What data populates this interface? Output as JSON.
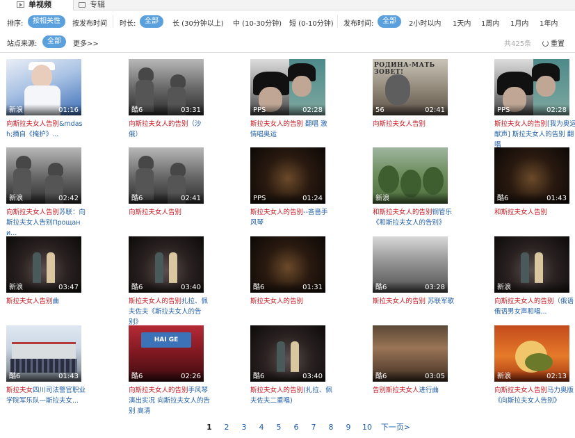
{
  "tabs": {
    "active": "单视频",
    "other": "专辑"
  },
  "filters": {
    "sort_label": "排序:",
    "sort_options": [
      "按相关性",
      "按发布时间"
    ],
    "duration_label": "时长:",
    "duration_options": [
      "全部",
      "长 (30分钟以上)",
      "中 (10-30分钟)",
      "短 (0-10分钟)"
    ],
    "publish_label": "发布时间:",
    "publish_options": [
      "全部",
      "2小时以内",
      "1天内",
      "1周内",
      "1月内",
      "1年内"
    ],
    "source_label": "站点来源:",
    "source_options": [
      "全部",
      "更多>>"
    ],
    "total_count": "共425条",
    "reset_label": "重置"
  },
  "colors": {
    "accent": "#5aa0dc",
    "link": "#1f5ea8",
    "highlight": "#c8161d"
  },
  "videos": [
    {
      "source": "新浪",
      "duration": "01:16",
      "title_hl": "向斯拉夫女人告别",
      "title_rest": "&mdash;摘自《掩护》...",
      "thumb": "nurse"
    },
    {
      "source": "酷6",
      "duration": "03:31",
      "title_hl": "向斯拉夫女人的告别",
      "title_rest": "（沙俄）",
      "thumb": "bw1"
    },
    {
      "source": "PPS",
      "duration": "02:28",
      "title_hl": "斯拉夫女人的告别",
      "title_rest": " 翻唱 激情唱奥运",
      "thumb": "soldier"
    },
    {
      "source": "56",
      "duration": "02:41",
      "title_hl": "向斯拉夫女人告别",
      "title_rest": "",
      "thumb": "poster"
    },
    {
      "source": "PPS",
      "duration": "02:28",
      "title_hl": "斯拉夫女人的告别",
      "title_rest": "[我为奥运献声] 斯拉夫女人的告别 翻唱",
      "thumb": "soldier"
    },
    {
      "source": "新浪",
      "duration": "02:42",
      "title_hl": "向斯拉夫女人告别",
      "title_rest": "苏联：向斯拉夫女人告别Прощани...",
      "thumb": "bw1"
    },
    {
      "source": "酷6",
      "duration": "02:41",
      "title_hl": "向斯拉夫女人告别",
      "title_rest": "",
      "thumb": "bw1"
    },
    {
      "source": "PPS",
      "duration": "01:24",
      "title_hl": "斯拉夫女人的告别",
      "title_rest": "--吝啬手风琴",
      "thumb": "dark"
    },
    {
      "source": "新浪",
      "duration": "",
      "title_hl": "和斯拉夫女人的告别",
      "title_rest": "铜管乐《和斯拉夫女人的告别》",
      "thumb": "green"
    },
    {
      "source": "酷6",
      "duration": "01:43",
      "title_hl": "和斯拉夫女人告别",
      "title_rest": "",
      "thumb": "dark"
    },
    {
      "source": "新浪",
      "duration": "03:47",
      "title_hl": "斯拉夫女人告别",
      "title_rest": "曲",
      "thumb": "stage"
    },
    {
      "source": "酷6",
      "duration": "03:40",
      "title_hl": "斯拉夫女人的告别",
      "title_rest": "扎拉、佩夫佐夫《斯拉夫女人的告别》",
      "thumb": "stage"
    },
    {
      "source": "酷6",
      "duration": "01:31",
      "title_hl": "斯拉夫女人的告别",
      "title_rest": "",
      "thumb": "dark"
    },
    {
      "source": "酷6",
      "duration": "03:28",
      "title_hl": "斯拉夫女人的告别",
      "title_rest": " 苏联军歌",
      "thumb": "land"
    },
    {
      "source": "新浪",
      "duration": "",
      "title_hl": "向斯拉夫女人的告别",
      "title_rest": "（俄语俄语男女声和唱...",
      "thumb": "stage"
    },
    {
      "source": "酷6",
      "duration": "01:43",
      "title_hl": "斯拉夫女",
      "title_rest": "四川司法警官职业学院军乐队—斯拉夫女...",
      "thumb": "school"
    },
    {
      "source": "酷6",
      "duration": "02:26",
      "title_hl": "向斯拉夫女人的告别",
      "title_rest": "手风琴演出实况 向斯拉夫女人的告别 高清",
      "thumb": "red"
    },
    {
      "source": "酷6",
      "duration": "03:40",
      "title_hl": "斯拉夫女人的告别",
      "title_rest": "(扎拉、佩夫佐夫二重唱)",
      "thumb": "stage"
    },
    {
      "source": "酷6",
      "duration": "03:05",
      "title_hl": "告别斯拉夫女人",
      "title_rest": "进行曲",
      "thumb": "crowd"
    },
    {
      "source": "新浪",
      "duration": "02:13",
      "title_hl": "向斯拉夫女人告别",
      "title_rest": "马力奥版《向斯拉夫女人告别》",
      "thumb": "ball"
    }
  ],
  "pagination": {
    "pages": [
      "1",
      "2",
      "3",
      "4",
      "5",
      "6",
      "7",
      "8",
      "9",
      "10"
    ],
    "current": "1",
    "next_label": "下一页>"
  }
}
